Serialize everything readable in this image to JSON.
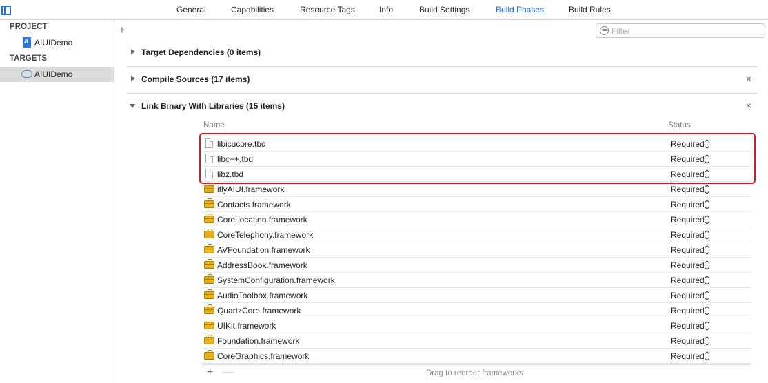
{
  "tabs": [
    {
      "label": "General",
      "active": false
    },
    {
      "label": "Capabilities",
      "active": false
    },
    {
      "label": "Resource Tags",
      "active": false
    },
    {
      "label": "Info",
      "active": false
    },
    {
      "label": "Build Settings",
      "active": false
    },
    {
      "label": "Build Phases",
      "active": true
    },
    {
      "label": "Build Rules",
      "active": false
    }
  ],
  "sidebar": {
    "project_header": "PROJECT",
    "project_item": "AIUIDemo",
    "targets_header": "TARGETS",
    "target_item": "AIUIDemo"
  },
  "filter": {
    "placeholder": "Filter"
  },
  "add_symbol": "+",
  "phases": [
    {
      "title": "Target Dependencies (0 items)",
      "expanded": false,
      "closable": false
    },
    {
      "title": "Compile Sources (17 items)",
      "expanded": false,
      "closable": true
    },
    {
      "title": "Link Binary With Libraries (15 items)",
      "expanded": true,
      "closable": true
    }
  ],
  "close_symbol": "×",
  "table": {
    "name_header": "Name",
    "status_header": "Status",
    "rows": [
      {
        "name": "libicucore.tbd",
        "status": "Required",
        "icon": "file-icon"
      },
      {
        "name": "libc++.tbd",
        "status": "Required",
        "icon": "file-icon"
      },
      {
        "name": "libz.tbd",
        "status": "Required",
        "icon": "file-icon"
      },
      {
        "name": "iflyAIUI.framework",
        "status": "Required",
        "icon": "framework-icon"
      },
      {
        "name": "Contacts.framework",
        "status": "Required",
        "icon": "framework-icon"
      },
      {
        "name": "CoreLocation.framework",
        "status": "Required",
        "icon": "framework-icon"
      },
      {
        "name": "CoreTelephony.framework",
        "status": "Required",
        "icon": "framework-icon"
      },
      {
        "name": "AVFoundation.framework",
        "status": "Required",
        "icon": "framework-icon"
      },
      {
        "name": "AddressBook.framework",
        "status": "Required",
        "icon": "framework-icon"
      },
      {
        "name": "SystemConfiguration.framework",
        "status": "Required",
        "icon": "framework-icon"
      },
      {
        "name": "AudioToolbox.framework",
        "status": "Required",
        "icon": "framework-icon"
      },
      {
        "name": "QuartzCore.framework",
        "status": "Required",
        "icon": "framework-icon"
      },
      {
        "name": "UIKit.framework",
        "status": "Required",
        "icon": "framework-icon"
      },
      {
        "name": "Foundation.framework",
        "status": "Required",
        "icon": "framework-icon"
      },
      {
        "name": "CoreGraphics.framework",
        "status": "Required",
        "icon": "framework-icon"
      }
    ]
  },
  "bottom": {
    "add": "+",
    "remove": "—",
    "hint": "Drag to reorder frameworks"
  },
  "colors": {
    "accent": "#1a6fe0",
    "highlight": "#e0141e"
  }
}
